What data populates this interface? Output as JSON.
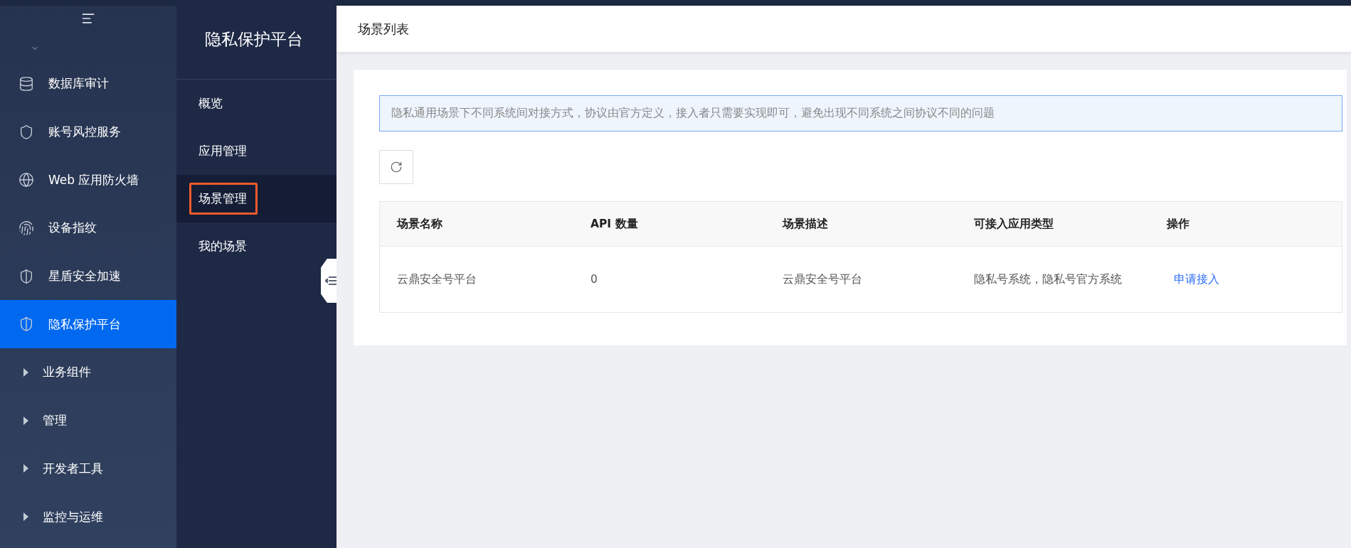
{
  "main_nav": {
    "items": [
      {
        "label": "数据库审计",
        "kind": "app",
        "selected": false
      },
      {
        "label": "账号风控服务",
        "kind": "app",
        "selected": false
      },
      {
        "label": "Web 应用防火墙",
        "kind": "app",
        "selected": false
      },
      {
        "label": "设备指纹",
        "kind": "app",
        "selected": false
      },
      {
        "label": "星盾安全加速",
        "kind": "app",
        "selected": false
      },
      {
        "label": "隐私保护平台",
        "kind": "app",
        "selected": true
      },
      {
        "label": "业务组件",
        "kind": "group",
        "selected": false
      },
      {
        "label": "管理",
        "kind": "group",
        "selected": false
      },
      {
        "label": "开发者工具",
        "kind": "group",
        "selected": false
      },
      {
        "label": "监控与运维",
        "kind": "group",
        "selected": false
      }
    ]
  },
  "sub_nav": {
    "title": "隐私保护平台",
    "items": [
      {
        "label": "概览",
        "selected": false,
        "highlighted": false
      },
      {
        "label": "应用管理",
        "selected": false,
        "highlighted": false
      },
      {
        "label": "场景管理",
        "selected": true,
        "highlighted": true
      },
      {
        "label": "我的场景",
        "selected": false,
        "highlighted": false
      }
    ]
  },
  "page": {
    "title": "场景列表",
    "notice": "隐私通用场景下不同系统间对接方式，协议由官方定义，接入者只需要实现即可，避免出现不同系统之间协议不同的问题",
    "table": {
      "columns": [
        "场景名称",
        "API 数量",
        "场景描述",
        "可接入应用类型",
        "操作"
      ],
      "rows": [
        {
          "cells": [
            "云鼎安全号平台",
            "0",
            "云鼎安全号平台",
            "隐私号系统，隐私号官方系统"
          ],
          "action": "申请接入"
        }
      ]
    }
  }
}
